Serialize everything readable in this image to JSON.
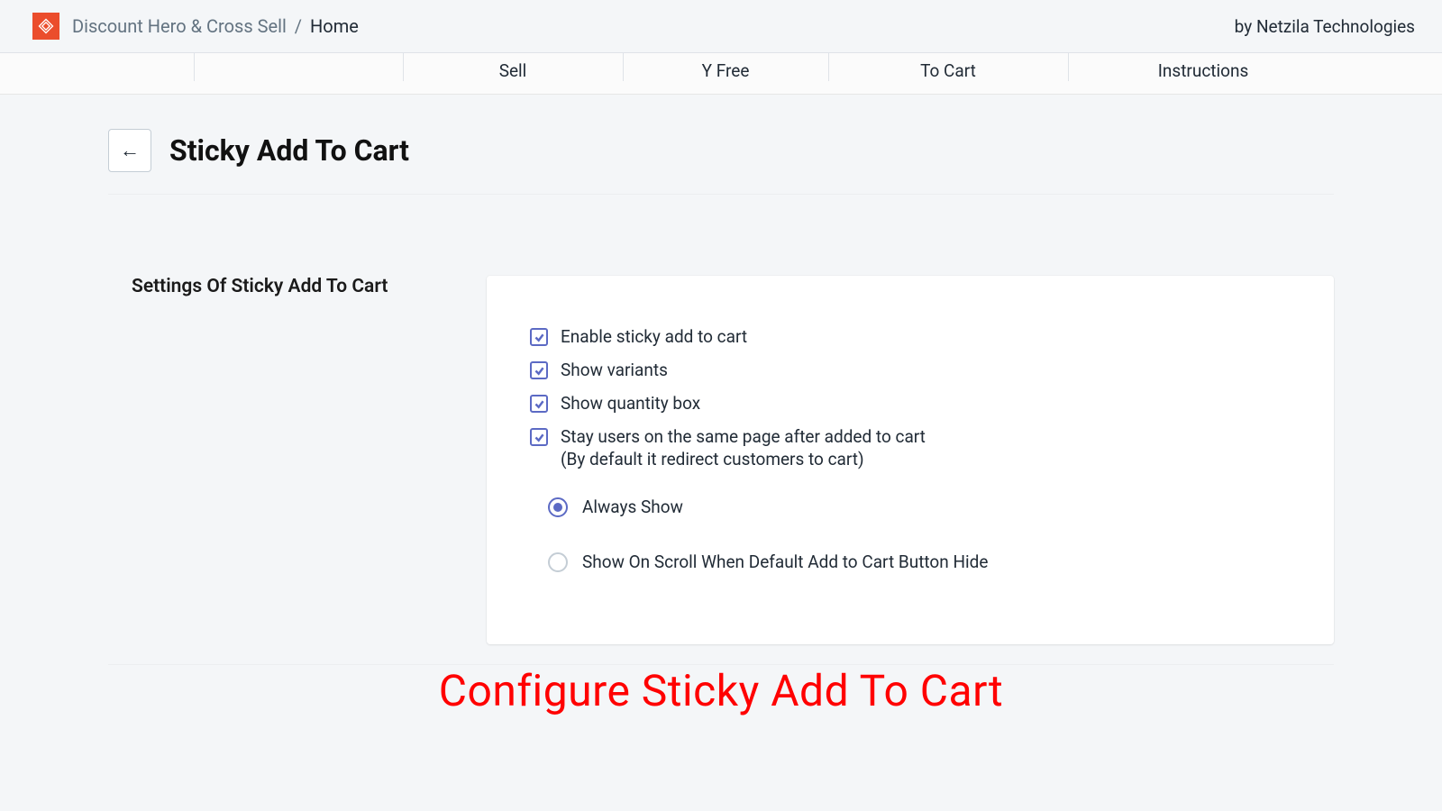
{
  "header": {
    "app_name": "Discount Hero & Cross Sell",
    "breadcrumb_current": "Home",
    "byline": "by Netzila Technologies",
    "logo_color": "#eb4d2c"
  },
  "tabs": [
    {
      "label": ""
    },
    {
      "label": ""
    },
    {
      "label": "Sell"
    },
    {
      "label": "Y Free"
    },
    {
      "label": "To Cart"
    },
    {
      "label": "Instructions"
    }
  ],
  "page": {
    "title": "Sticky Add To Cart",
    "section_label": "Settings Of Sticky Add To Cart"
  },
  "checkboxes": [
    {
      "label": "Enable sticky add to cart",
      "checked": true
    },
    {
      "label": "Show variants",
      "checked": true
    },
    {
      "label": "Show quantity box",
      "checked": true
    },
    {
      "label": "Stay users on the same page after added to cart",
      "sub": "(By default it redirect customers to cart)",
      "checked": true
    }
  ],
  "radios": [
    {
      "label": "Always Show",
      "selected": true
    },
    {
      "label": "Show On Scroll When Default Add to Cart Button Hide",
      "selected": false
    }
  ],
  "caption": "Configure Sticky Add To Cart"
}
